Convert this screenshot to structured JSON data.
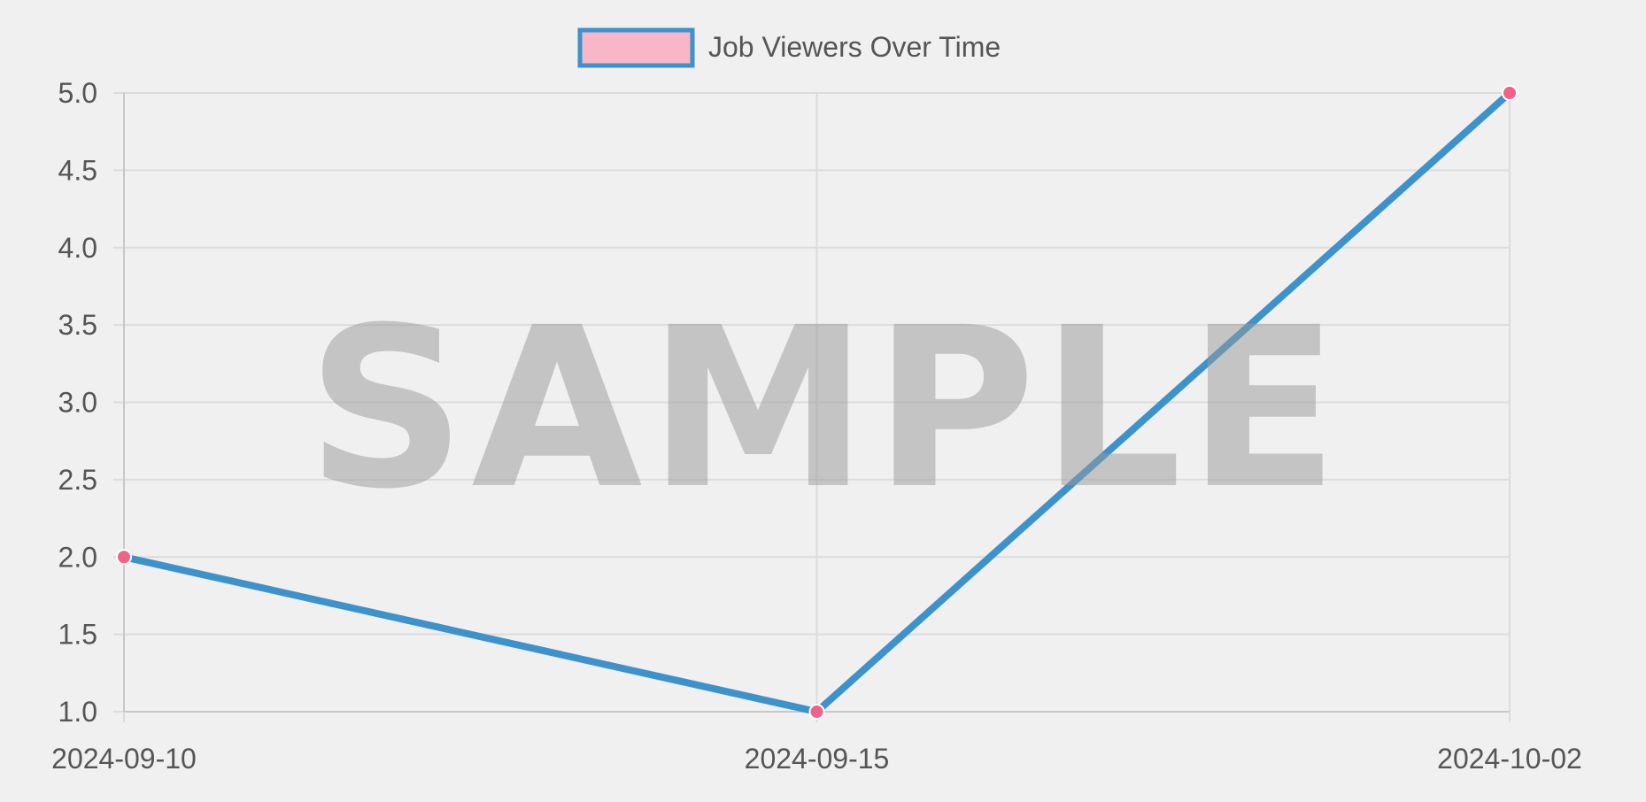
{
  "chart_data": {
    "type": "line",
    "x": [
      "2024-09-10",
      "2024-09-15",
      "2024-10-02"
    ],
    "series": [
      {
        "name": "Job Viewers Over Time",
        "values": [
          2,
          1,
          5
        ],
        "line_color": "#3d92cc",
        "point_color": "#f0628a",
        "legend_fill": "#f7b7c6"
      }
    ],
    "ylim": [
      1,
      5
    ],
    "y_ticks": [
      "1.0",
      "1.5",
      "2.0",
      "2.5",
      "3.0",
      "3.5",
      "4.0",
      "4.5",
      "5.0"
    ],
    "grid": true,
    "legend_position": "top-center"
  },
  "watermark": {
    "text": "SAMPLE",
    "color": "#9a9a9a"
  }
}
